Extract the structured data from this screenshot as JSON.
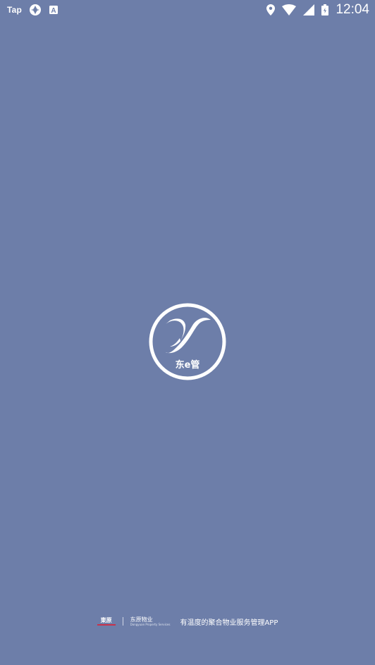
{
  "status_bar": {
    "left_label": "Tap",
    "left_icons": [
      "navigation-icon",
      "a-badge-icon"
    ],
    "right_icons": [
      "location-icon",
      "wifi-icon",
      "signal-icon",
      "battery-icon"
    ],
    "time": "12:04"
  },
  "splash": {
    "logo_text": "东e管"
  },
  "footer": {
    "brand_primary": "東原",
    "brand_secondary": "东原物业",
    "brand_secondary_sub": "Dongyuan Property Services",
    "tagline": "有温度的聚合物业服务管理APP"
  },
  "colors": {
    "background": "#6d7ea9",
    "foreground": "#ffffff",
    "brand_accent": "#c8324a"
  }
}
